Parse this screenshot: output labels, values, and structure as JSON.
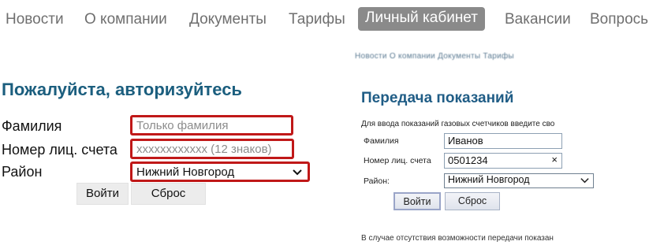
{
  "nav": {
    "items": [
      {
        "label": "Новости"
      },
      {
        "label": "О компании"
      },
      {
        "label": "Документы"
      },
      {
        "label": "Тарифы"
      },
      {
        "label": "Личный кабинет",
        "active": true
      },
      {
        "label": "Вакансии"
      },
      {
        "label": "Вопрось"
      }
    ]
  },
  "login_form": {
    "title": "Пожалуйста, авторизуйтесь",
    "surname_label": "Фамилия",
    "surname_placeholder": "Только фамилия",
    "account_label": "Номер лиц. счета",
    "account_placeholder": "xxxxxxxxxxxx (12 знаков)",
    "district_label": "Район",
    "district_value": "Нижний Новгород",
    "login_button": "Войти",
    "reset_button": "Сброс",
    "highlight_color": "#c01818"
  },
  "readings_screenshot": {
    "nav_text": "Новости   О компании   Документы   Тарифы",
    "title": "Передача показаний",
    "intro": "Для ввода показаний газовых счетчиков введите сво",
    "surname_label": "Фамилия",
    "surname_value": "Иванов",
    "account_label": "Номер лиц. счета",
    "account_value": "0501234",
    "clear_glyph": "×",
    "district_label": "Район:",
    "district_value": "Нижний Новгород",
    "login_button": "Войти",
    "reset_button": "Сброс",
    "footer_text": "В случае отсутствия возможности передачи показан"
  },
  "icons": {
    "chevron": "chevron-down-icon"
  }
}
